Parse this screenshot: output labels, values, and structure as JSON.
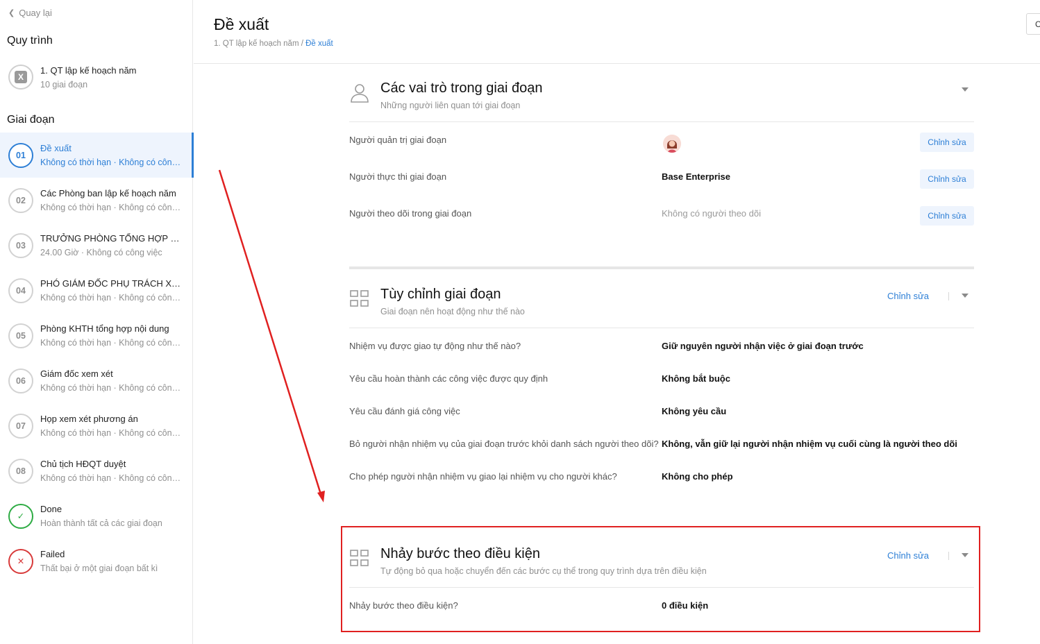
{
  "sidebar": {
    "back_label": "Quay lại",
    "process_section": "Quy trình",
    "process": {
      "name": "1. QT lập kế hoạch năm",
      "meta": "10 giai đoạn"
    },
    "stage_section": "Giai đoạn",
    "stages": [
      {
        "num": "01",
        "name": "Đề xuất",
        "meta": "Không có thời hạn · Không có công việc",
        "active": true
      },
      {
        "num": "02",
        "name": "Các Phòng ban lập kế hoạch năm",
        "meta": "Không có thời hạn · Không có công việc"
      },
      {
        "num": "03",
        "name": "TRƯỞNG PHÒNG TỔNG HỢP KẾ HOẠCH",
        "meta": "24.00 Giờ · Không có công việc"
      },
      {
        "num": "04",
        "name": "PHÓ GIÁM ĐỐC PHỤ TRÁCH XEM XÉT",
        "meta": "Không có thời hạn · Không có công việc"
      },
      {
        "num": "05",
        "name": "Phòng KHTH tổng hợp nội dung",
        "meta": "Không có thời hạn · Không có công việc"
      },
      {
        "num": "06",
        "name": "Giám đốc xem xét",
        "meta": "Không có thời hạn · Không có công việc"
      },
      {
        "num": "07",
        "name": "Họp xem xét phương án",
        "meta": "Không có thời hạn · Không có công việc"
      },
      {
        "num": "08",
        "name": "Chủ tịch HĐQT duyệt",
        "meta": "Không có thời hạn · Không có công việc"
      },
      {
        "num": "✓",
        "name": "Done",
        "meta": "Hoàn thành tất cả các giai đoạn"
      },
      {
        "num": "✕",
        "name": "Failed",
        "meta": "Thất bại ở một giai đoạn bất kì"
      }
    ]
  },
  "header": {
    "title": "Đề xuất",
    "breadcrumb_parent": "1. QT lập kế hoạch năm",
    "breadcrumb_sep": " / ",
    "breadcrumb_current": "Đề xuất",
    "top_button": "C"
  },
  "roles": {
    "title": "Các vai trò trong giai đoạn",
    "subtitle": "Những người liên quan tới giai đoạn",
    "edit_label": "Chỉnh sửa",
    "rows": [
      {
        "label": "Người quản trị giai đoạn",
        "value": ""
      },
      {
        "label": "Người thực thi giai đoạn",
        "value": "Base Enterprise"
      },
      {
        "label": "Người theo dõi trong giai đoạn",
        "value": "Không có người theo dõi"
      }
    ]
  },
  "custom": {
    "title": "Tùy chỉnh giai đoạn",
    "subtitle": "Giai đoạn nên hoạt động như thế nào",
    "edit_label": "Chỉnh sửa",
    "rows": [
      {
        "label": "Nhiệm vụ được giao tự động như thế nào?",
        "value": "Giữ nguyên người nhận việc ở giai đoạn trước"
      },
      {
        "label": "Yêu cầu hoàn thành các công việc được quy định",
        "value": "Không bắt buộc"
      },
      {
        "label": "Yêu cầu đánh giá công việc",
        "value": "Không yêu cầu"
      },
      {
        "label": "Bỏ người nhận nhiệm vụ của giai đoạn trước khỏi danh sách người theo dõi?",
        "value": "Không, vẫn giữ lại người nhận nhiệm vụ cuối cùng là người theo dõi"
      },
      {
        "label": "Cho phép người nhận nhiệm vụ giao lại nhiệm vụ cho người khác?",
        "value": "Không cho phép"
      }
    ]
  },
  "conditional": {
    "title": "Nhảy bước theo điều kiện",
    "subtitle": "Tự động bỏ qua hoặc chuyển đến các bước cụ thể trong quy trình dựa trên điều kiện",
    "edit_label": "Chỉnh sửa",
    "rows": [
      {
        "label": "Nhảy bước theo điều kiện?",
        "value": "0 điều kiện"
      }
    ]
  },
  "colors": {
    "accent": "#2d7fd6",
    "highlight": "#e02020",
    "done": "#2dab43",
    "fail": "#d83a3a"
  }
}
